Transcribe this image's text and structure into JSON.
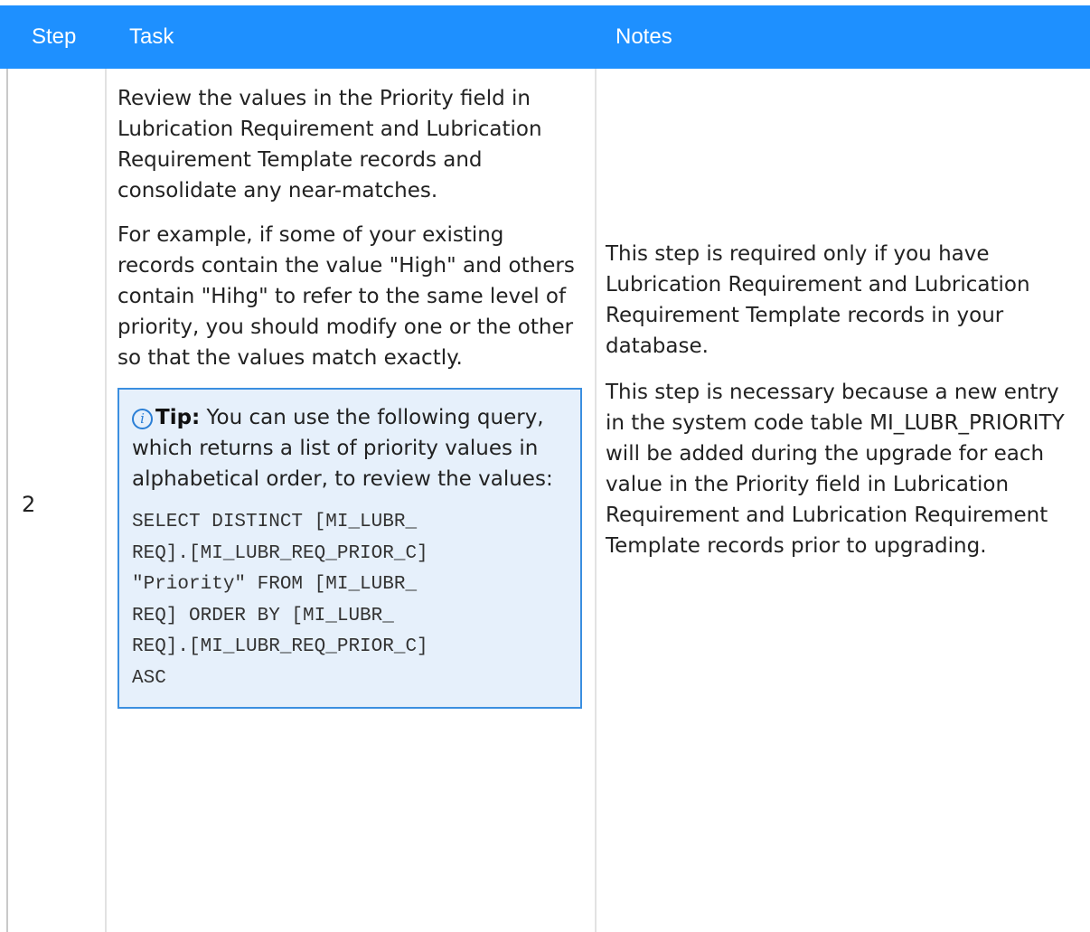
{
  "header": {
    "step": "Step",
    "task": "Task",
    "notes": "Notes"
  },
  "row": {
    "step": "2",
    "task": {
      "paragraph_1": "Review the values in the Priority field in Lubrication Requirement and Lubrication Requirement Template records and consolidate any near-matches.",
      "paragraph_2": "For example, if some of your existing records contain the value \"High\" and others contain \"Hihg\" to refer to the same level of priority, you should modify one or the other so that the values match exactly.",
      "tip": {
        "icon": "info-icon",
        "label": "Tip:",
        "text": "You can use the following query, which returns a list of priority values in alphabetical order, to review the values:",
        "code": "SELECT DISTINCT [MI_LUBR_REQ].[MI_LUBR_REQ_PRIOR_C] \"Priority\" FROM [MI_LUBR_REQ] ORDER BY [MI_LUBR_REQ].[MI_LUBR_REQ_PRIOR_C] ASC"
      }
    },
    "notes": {
      "paragraph_1": "This step is required only if you have Lubrication Requirement and Lubrication Requirement Template records in your database.",
      "paragraph_2": "This step is necessary because a new entry in the system code table MI_LUBR_PRIORITY will be added during the upgrade for each value in the Priority field in Lubrication Requirement and Lubrication Requirement Template records prior to upgrading."
    }
  },
  "colors": {
    "header_background": "#1e90ff",
    "tip_background": "#e6f0fb",
    "tip_border": "#3b8fe0"
  }
}
